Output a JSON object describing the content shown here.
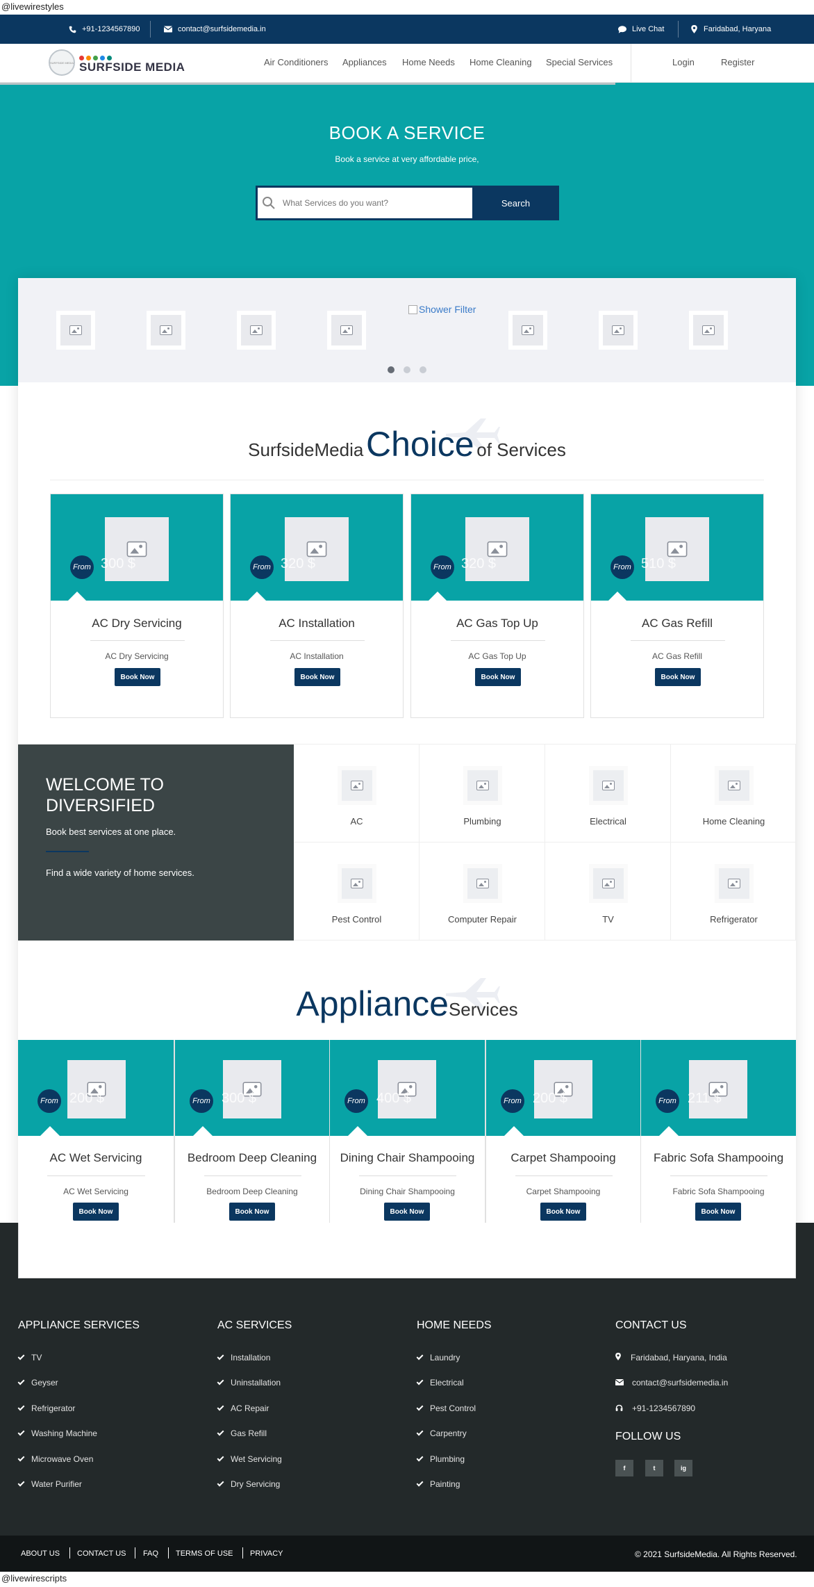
{
  "stray_top": "@livewirestyles",
  "stray_bottom": "@livewirescripts",
  "topbar": {
    "phone": "+91-1234567890",
    "email": "contact@surfsidemedia.in",
    "live_chat": "Live Chat",
    "location": "Faridabad, Haryana"
  },
  "header": {
    "logo_text": "SURFSIDE MEDIA",
    "logo_small": "SURFSIDE MEDIA",
    "nav": [
      "Air Conditioners",
      "Appliances",
      "Home Needs",
      "Home Cleaning",
      "Special Services"
    ],
    "login": "Login",
    "register": "Register"
  },
  "hero": {
    "title": "BOOK A SERVICE",
    "subtitle": "Book a service at very affordable price,",
    "search_placeholder": "What Services do you want?",
    "search_button": "Search"
  },
  "slider": {
    "link_label": "Shower Filter"
  },
  "choice": {
    "heading_left": "SurfsideMedia",
    "heading_big": "Choice",
    "heading_right": "of Services",
    "cards": [
      {
        "from": "From",
        "price": "300",
        "title": "AC Dry Servicing",
        "sub": "AC Dry Servicing",
        "button": "Book Now"
      },
      {
        "from": "From",
        "price": "320",
        "title": "AC Installation",
        "sub": "AC Installation",
        "button": "Book Now"
      },
      {
        "from": "From",
        "price": "320",
        "title": "AC Gas Top Up",
        "sub": "AC Gas Top Up",
        "button": "Book Now"
      },
      {
        "from": "From",
        "price": "510",
        "title": "AC Gas Refill",
        "sub": "AC Gas Refill",
        "button": "Book Now"
      }
    ]
  },
  "welcome": {
    "title": "WELCOME TO DIVERSIFIED",
    "subtitle": "Book best services at one place.",
    "description": "Find a wide variety of home services."
  },
  "categories": [
    "AC",
    "Plumbing",
    "Electrical",
    "Home Cleaning",
    "Pest Control",
    "Computer Repair",
    "TV",
    "Refrigerator"
  ],
  "appliance": {
    "heading_big": "Appliance",
    "heading_right": "Services",
    "cards": [
      {
        "from": "From",
        "price": "200",
        "title": "AC Wet Servicing",
        "sub": "AC Wet Servicing",
        "button": "Book Now"
      },
      {
        "from": "From",
        "price": "300",
        "title": "Bedroom Deep Cleaning",
        "sub": "Bedroom Deep Cleaning",
        "button": "Book Now"
      },
      {
        "from": "From",
        "price": "400",
        "title": "Dining Chair Shampooing",
        "sub": "Dining Chair Shampooing",
        "button": "Book Now"
      },
      {
        "from": "From",
        "price": "200",
        "title": "Carpet Shampooing",
        "sub": "Carpet Shampooing",
        "button": "Book Now"
      },
      {
        "from": "From",
        "price": "211",
        "title": "Fabric Sofa Shampooing",
        "sub": "Fabric Sofa Shampooing",
        "button": "Book Now"
      }
    ]
  },
  "footer": {
    "appliance_head": "APPLIANCE SERVICES",
    "appliance_items": [
      "TV",
      "Geyser",
      "Refrigerator",
      "Washing Machine",
      "Microwave Oven",
      "Water Purifier"
    ],
    "ac_head": "AC SERVICES",
    "ac_items": [
      "Installation",
      "Uninstallation",
      "AC Repair",
      "Gas Refill",
      "Wet Servicing",
      "Dry Servicing"
    ],
    "home_head": "HOME NEEDS",
    "home_items": [
      "Laundry",
      "Electrical",
      "Pest Control",
      "Carpentry",
      "Plumbing",
      "Painting"
    ],
    "contact_head": "CONTACT US",
    "contact_address": "Faridabad, Haryana, India",
    "contact_email": "contact@surfsidemedia.in",
    "contact_phone": "+91-1234567890",
    "follow_head": "FOLLOW US",
    "social": [
      "f",
      "t",
      "ig"
    ]
  },
  "bottom": {
    "links": [
      "ABOUT US",
      "CONTACT US",
      "FAQ",
      "TERMS OF USE",
      "PRIVACY"
    ],
    "copyright": "© 2021 SurfsideMedia. All Rights Reserved."
  },
  "colors": {
    "navy": "#0b3760",
    "teal": "#08a3a6",
    "dark_panel": "#3b4546",
    "footer": "#23292a"
  }
}
